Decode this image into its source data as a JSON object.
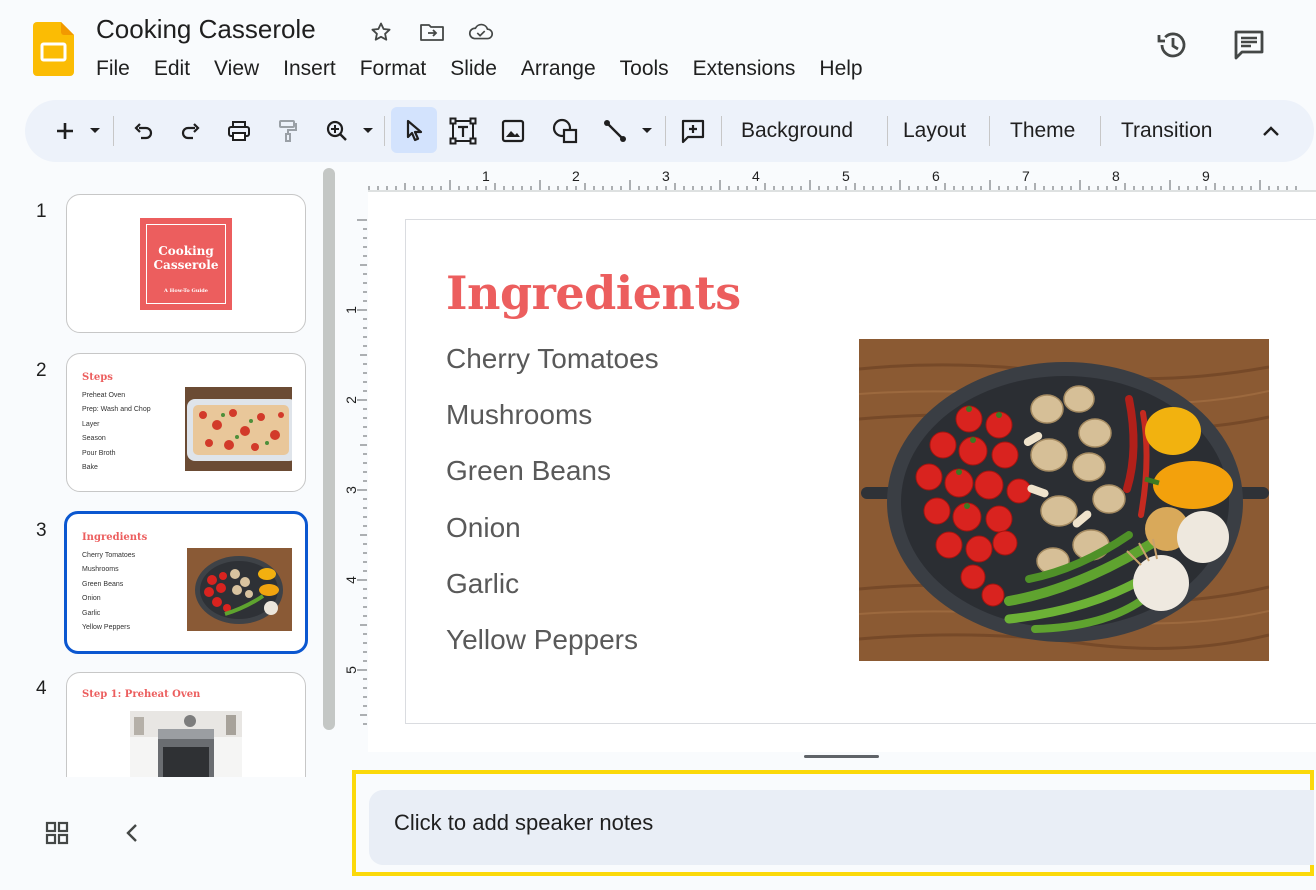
{
  "app": {
    "doc_title": "Cooking Casserole",
    "menu": [
      "File",
      "Edit",
      "View",
      "Insert",
      "Format",
      "Slide",
      "Arrange",
      "Tools",
      "Extensions",
      "Help"
    ]
  },
  "toolbar": {
    "background_label": "Background",
    "layout_label": "Layout",
    "theme_label": "Theme",
    "transition_label": "Transition"
  },
  "filmstrip": {
    "slides": [
      {
        "number": "1",
        "title_line1": "Cooking",
        "title_line2": "Casserole",
        "subtitle": "A How-To Guide"
      },
      {
        "number": "2",
        "title": "Steps",
        "items": [
          "Preheat Oven",
          "Prep: Wash and Chop",
          "Layer",
          "Season",
          "Pour Broth",
          "Bake"
        ]
      },
      {
        "number": "3",
        "title": "Ingredients",
        "items": [
          "Cherry Tomatoes",
          "Mushrooms",
          "Green Beans",
          "Onion",
          "Garlic",
          "Yellow Peppers"
        ]
      },
      {
        "number": "4",
        "title": "Step 1: Preheat Oven"
      }
    ],
    "selected_slide": 3
  },
  "ruler": {
    "horizontal": [
      "1",
      "2",
      "3",
      "4",
      "5",
      "6",
      "7",
      "8",
      "9"
    ],
    "vertical": [
      "1",
      "2",
      "3",
      "4",
      "5"
    ]
  },
  "slide": {
    "title": "Ingredients",
    "bullets": [
      "Cherry Tomatoes",
      "Mushrooms",
      "Green Beans",
      "Onion",
      "Garlic",
      "Yellow Peppers"
    ]
  },
  "notes": {
    "placeholder": "Click to add speaker notes"
  },
  "colors": {
    "accent": "#ec5e5e",
    "selection": "#0b57d0",
    "highlight_outline": "#fbd90a",
    "app_icon": "#fbbc04"
  }
}
